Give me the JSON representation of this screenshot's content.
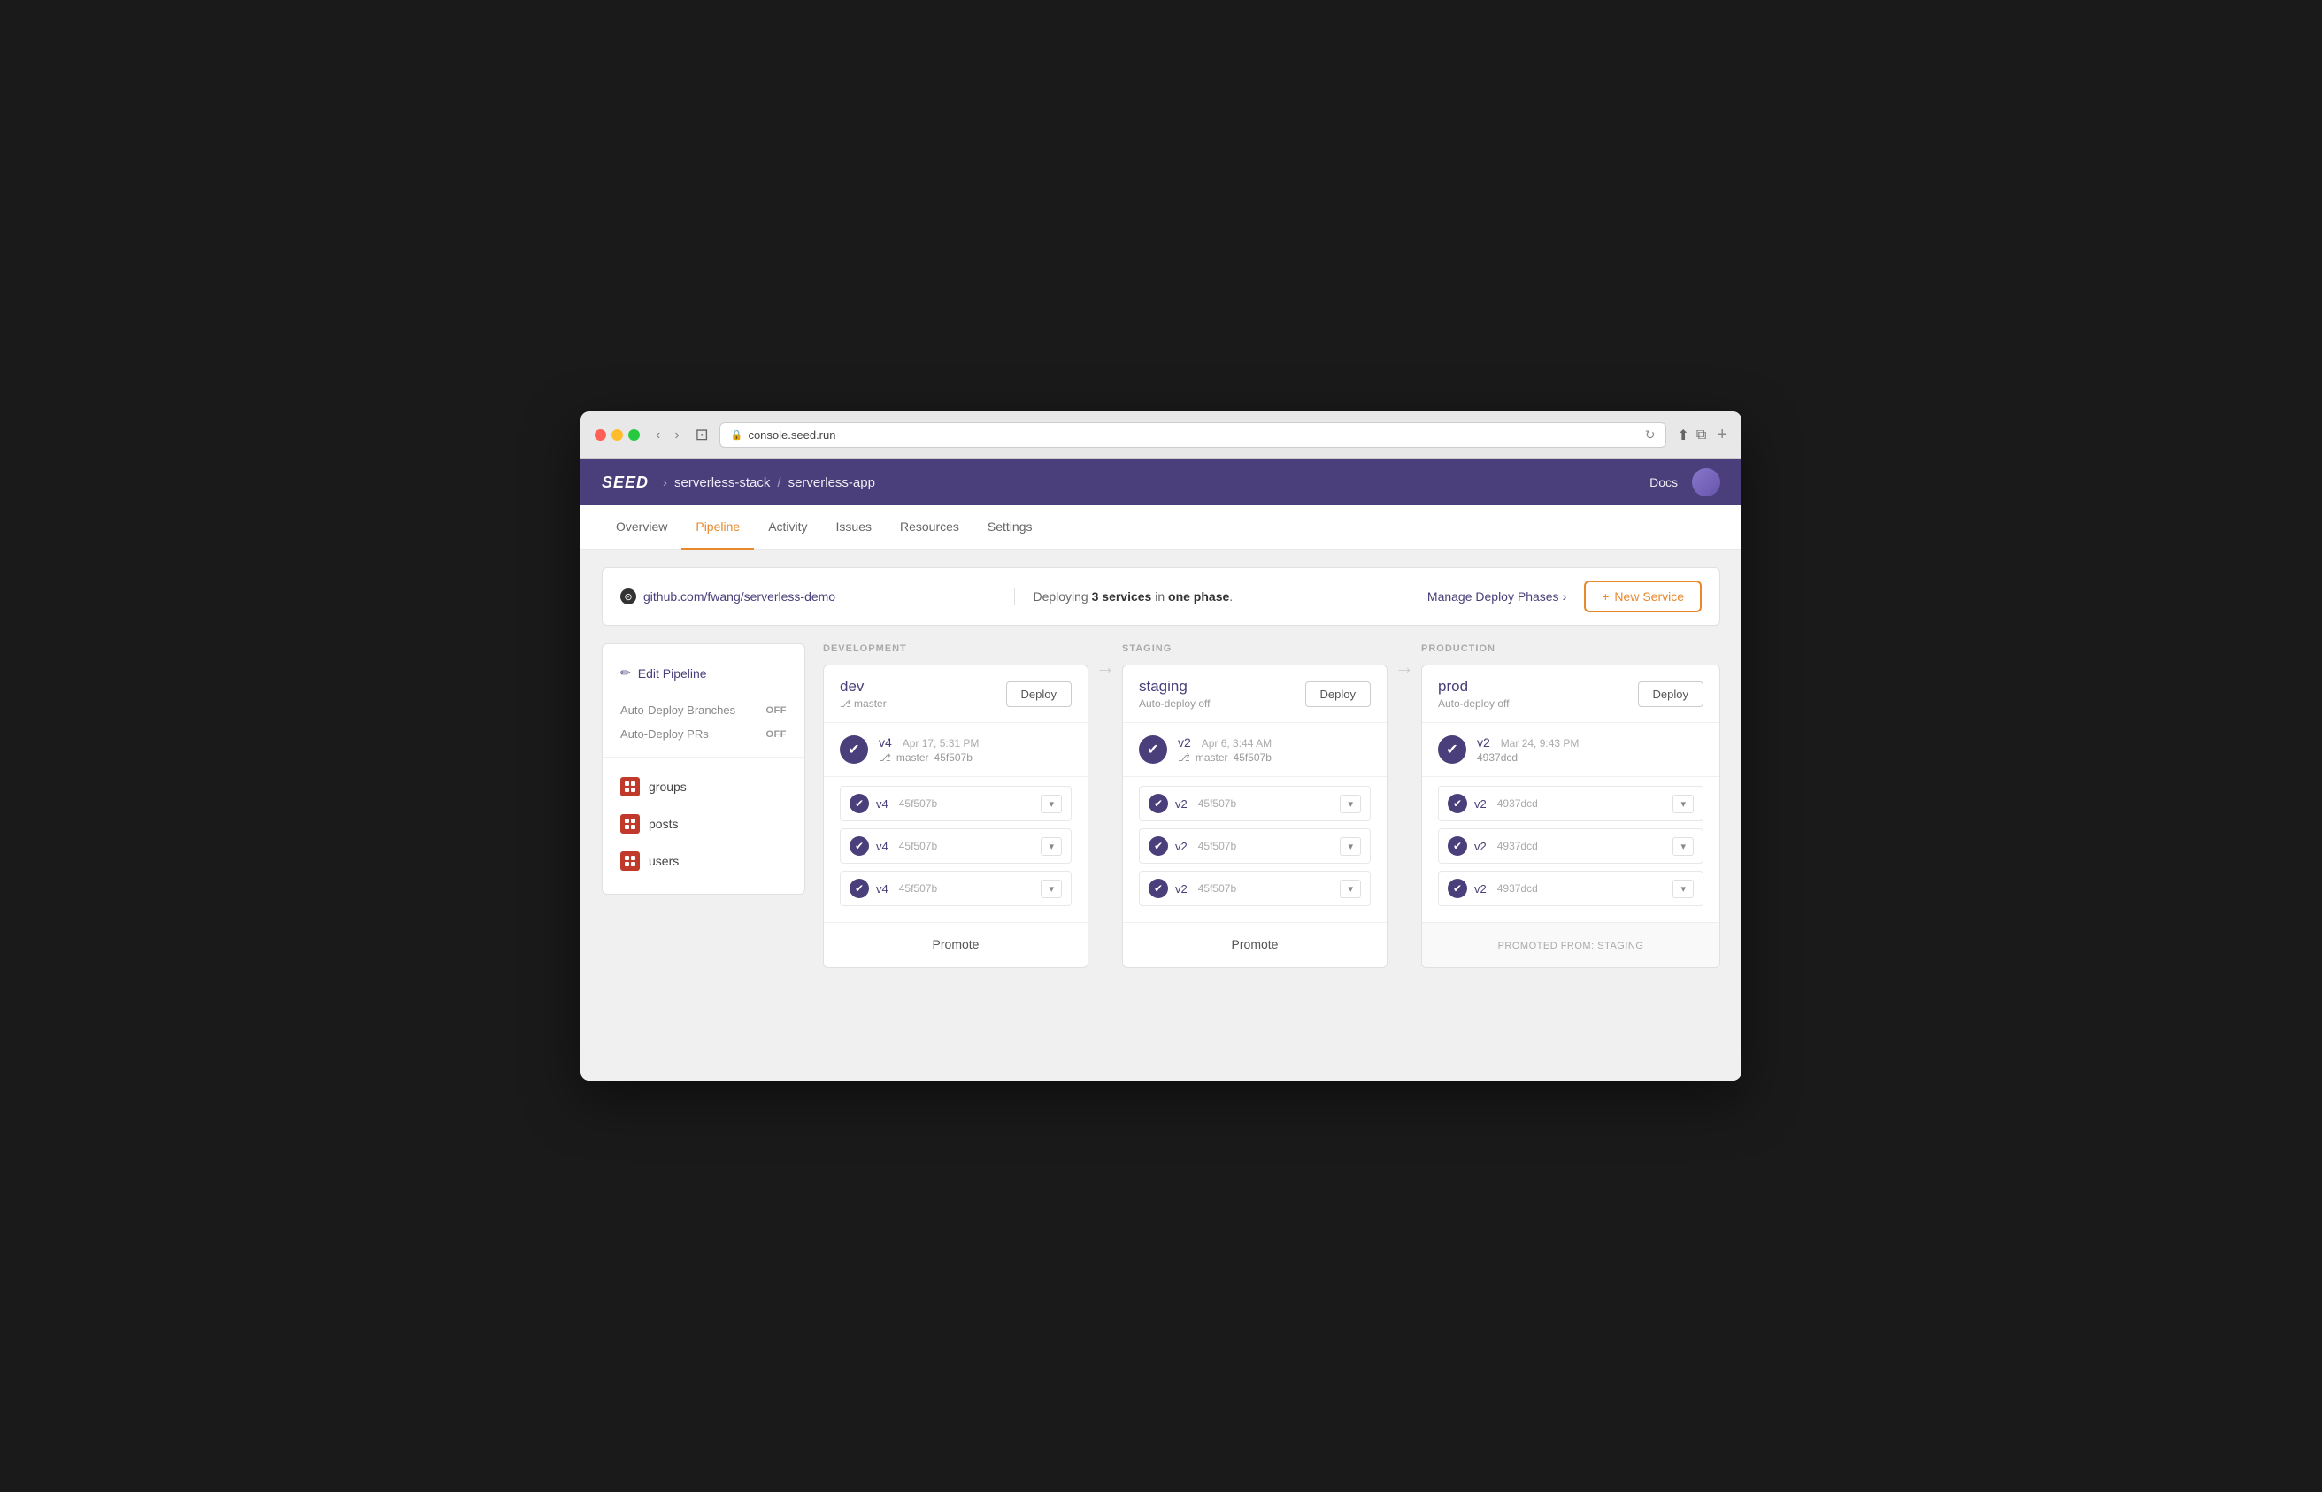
{
  "browser": {
    "url": "console.seed.run",
    "back_label": "‹",
    "forward_label": "›"
  },
  "app": {
    "logo": "SEED",
    "breadcrumb": {
      "org": "serverless-stack",
      "sep": "/",
      "app": "serverless-app"
    },
    "docs_label": "Docs",
    "nav_tabs": [
      {
        "id": "overview",
        "label": "Overview",
        "active": false
      },
      {
        "id": "pipeline",
        "label": "Pipeline",
        "active": true
      },
      {
        "id": "activity",
        "label": "Activity",
        "active": false
      },
      {
        "id": "issues",
        "label": "Issues",
        "active": false
      },
      {
        "id": "resources",
        "label": "Resources",
        "active": false
      },
      {
        "id": "settings",
        "label": "Settings",
        "active": false
      }
    ]
  },
  "info_bar": {
    "github_url": "github.com/fwang/serverless-demo",
    "deploy_text_prefix": "Deploying ",
    "deploy_bold": "3 services",
    "deploy_text_mid": " in ",
    "deploy_bold2": "one phase",
    "deploy_text_suffix": ".",
    "manage_phases_label": "Manage Deploy Phases",
    "manage_phases_arrow": "›",
    "new_service_icon": "+",
    "new_service_label": "New Service"
  },
  "sidebar": {
    "edit_pipeline_label": "Edit Pipeline",
    "settings": [
      {
        "label": "Auto-Deploy Branches",
        "value": "OFF"
      },
      {
        "label": "Auto-Deploy PRs",
        "value": "OFF"
      }
    ],
    "services": [
      {
        "name": "groups"
      },
      {
        "name": "posts"
      },
      {
        "name": "users"
      }
    ]
  },
  "stages": [
    {
      "id": "development",
      "header": "DEVELOPMENT",
      "env_name": "dev",
      "auto_deploy": "ᵞ master",
      "deploy_label": "Deploy",
      "main_build": {
        "version": "v4",
        "date": "Apr 17, 5:31 PM",
        "branch": "master",
        "hash": "45f507b"
      },
      "services": [
        {
          "version": "v4",
          "hash": "45f507b"
        },
        {
          "version": "v4",
          "hash": "45f507b"
        },
        {
          "version": "v4",
          "hash": "45f507b"
        }
      ],
      "action": "Promote",
      "action_type": "promote"
    },
    {
      "id": "staging",
      "header": "STAGING",
      "env_name": "staging",
      "auto_deploy": "Auto-deploy off",
      "deploy_label": "Deploy",
      "main_build": {
        "version": "v2",
        "date": "Apr 6, 3:44 AM",
        "branch": "master",
        "hash": "45f507b"
      },
      "services": [
        {
          "version": "v2",
          "hash": "45f507b"
        },
        {
          "version": "v2",
          "hash": "45f507b"
        },
        {
          "version": "v2",
          "hash": "45f507b"
        }
      ],
      "action": "Promote",
      "action_type": "promote"
    },
    {
      "id": "production",
      "header": "PRODUCTION",
      "env_name": "prod",
      "auto_deploy": "Auto-deploy off",
      "deploy_label": "Deploy",
      "main_build": {
        "version": "v2",
        "date": "Mar 24, 9:43 PM",
        "branch": null,
        "hash": "4937dcd"
      },
      "services": [
        {
          "version": "v2",
          "hash": "4937dcd"
        },
        {
          "version": "v2",
          "hash": "4937dcd"
        },
        {
          "version": "v2",
          "hash": "4937dcd"
        }
      ],
      "action": "PROMOTED FROM: staging",
      "action_type": "promoted"
    }
  ]
}
